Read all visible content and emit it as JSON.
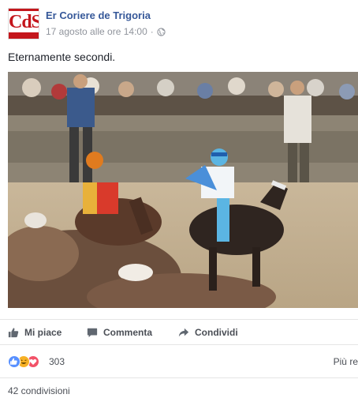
{
  "post": {
    "page_name": "Er Coriere de Trigoria",
    "timestamp": "17 agosto alle ore 14:00",
    "separator": "·",
    "privacy_icon": "globe-icon",
    "text": "Eternamente secondi.",
    "logo_text": "CdS"
  },
  "photo": {
    "subject": "horse-race-photo"
  },
  "actions": {
    "like_label": "Mi piace",
    "comment_label": "Commenta",
    "share_label": "Condividi"
  },
  "reactions": {
    "icons": [
      "like-icon",
      "haha-icon",
      "love-icon"
    ],
    "count": "303",
    "more_label": "Più rec"
  },
  "shares": {
    "label": "42 condivisioni"
  },
  "colors": {
    "link_blue": "#365899",
    "logo_red": "#c4161c",
    "like_blue": "#5890ff",
    "haha_yellow": "#f7b125",
    "love_red": "#f25268"
  }
}
